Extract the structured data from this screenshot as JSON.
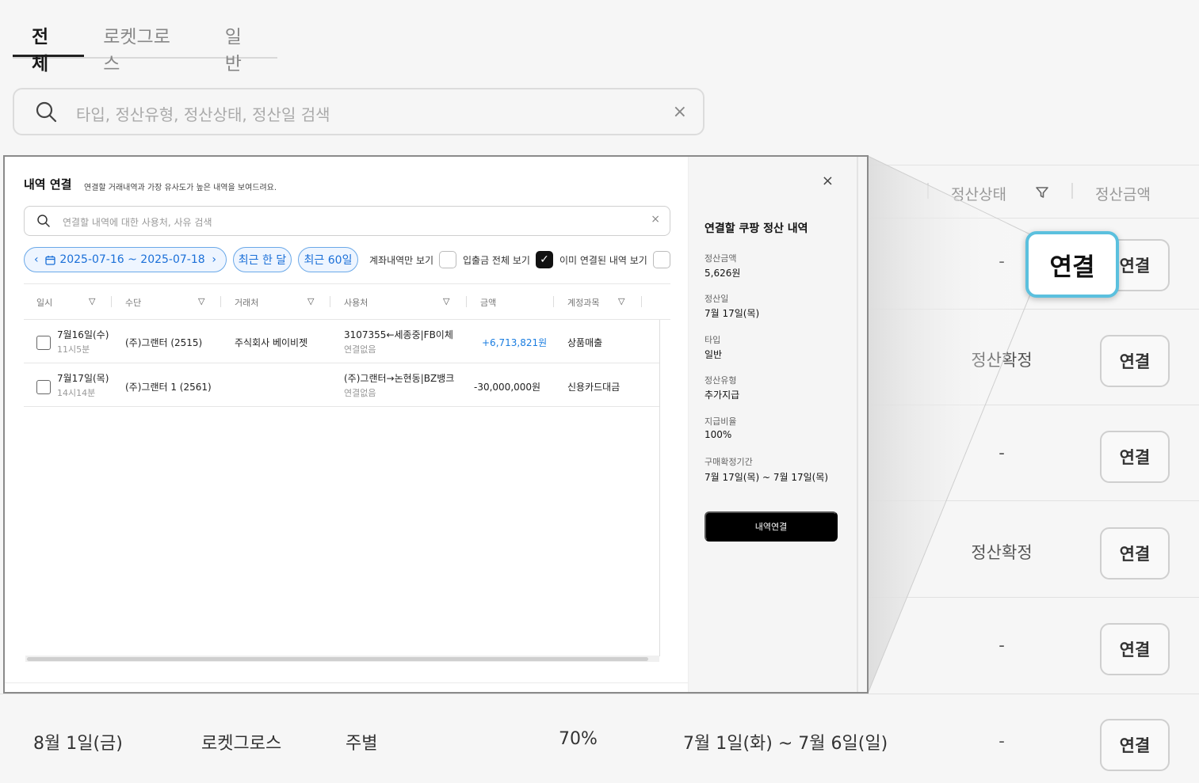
{
  "tabs": [
    "전체",
    "로켓그로스",
    "일반"
  ],
  "search": {
    "placeholder": "타입, 정산유형, 정산상태, 정산일 검색",
    "clear": "×"
  },
  "table_header": {
    "status": "정산상태",
    "amount": "정산금액"
  },
  "rows": [
    {
      "status": "-",
      "action": "연결"
    },
    {
      "status": "정산확정",
      "action": "연결"
    },
    {
      "status": "-",
      "action": "연결"
    },
    {
      "status": "정산확정",
      "action": "연결"
    },
    {
      "status": "-",
      "action": "연결"
    }
  ],
  "bottom_row": {
    "date": "8월 1일(금)",
    "type": "로켓그로스",
    "settlement_type": "주별",
    "rate": "70%",
    "period": "7월 1일(화) ~ 7월 6일(일)",
    "status": "-",
    "action": "연결"
  },
  "zoom_callout": "연결",
  "modal": {
    "title": "내역 연결",
    "subtitle": "연결할 거래내역과 가장 유사도가 높은 내역을 보여드려요.",
    "search_placeholder": "연결할 내역에 대한 사용처, 사유 검색",
    "date_range": "2025-07-16 ~ 2025-07-18",
    "chips": [
      "최근 한 달",
      "최근 60일"
    ],
    "checks": [
      {
        "label": "계좌내역만 보기",
        "checked": false
      },
      {
        "label": "입출금 전체 보기",
        "checked": true
      },
      {
        "label": "이미 연결된 내역 보기",
        "checked": false
      }
    ],
    "columns": [
      "일시",
      "수단",
      "거래처",
      "사용처",
      "금액",
      "계정과목"
    ],
    "rows": [
      {
        "date": "7월16일(수)",
        "time": "11시5분",
        "method": "(주)그랜터 (2515)",
        "vendor": "주식회사 베이비젯",
        "usage": "3107355←세종중|FB이체",
        "usage_sub": "연결없음",
        "amount": "+6,713,821원",
        "account": "상품매출"
      },
      {
        "date": "7월17일(목)",
        "time": "14시14분",
        "method": "(주)그랜터 1 (2561)",
        "vendor": "",
        "usage": "(주)그랜터→논현동|BZ뱅크",
        "usage_sub": "연결없음",
        "amount": "-30,000,000원",
        "account": "신용카드대금"
      }
    ],
    "detail": {
      "title": "연결할 쿠팡 정산 내역",
      "fields": [
        {
          "label": "정산금액",
          "value": "5,626원"
        },
        {
          "label": "정산일",
          "value": "7월 17일(목)"
        },
        {
          "label": "타입",
          "value": "일반"
        },
        {
          "label": "정산유형",
          "value": "추가지급"
        },
        {
          "label": "지급비율",
          "value": "100%"
        },
        {
          "label": "구매확정기간",
          "value": "7월 17일(목) ~ 7월 17일(목)"
        }
      ],
      "button": "내역연결",
      "close": "×"
    }
  },
  "colors": {
    "accent_blue": "#1a6fd8",
    "callout_border": "#5bc0de",
    "primary_button": "#000000"
  }
}
